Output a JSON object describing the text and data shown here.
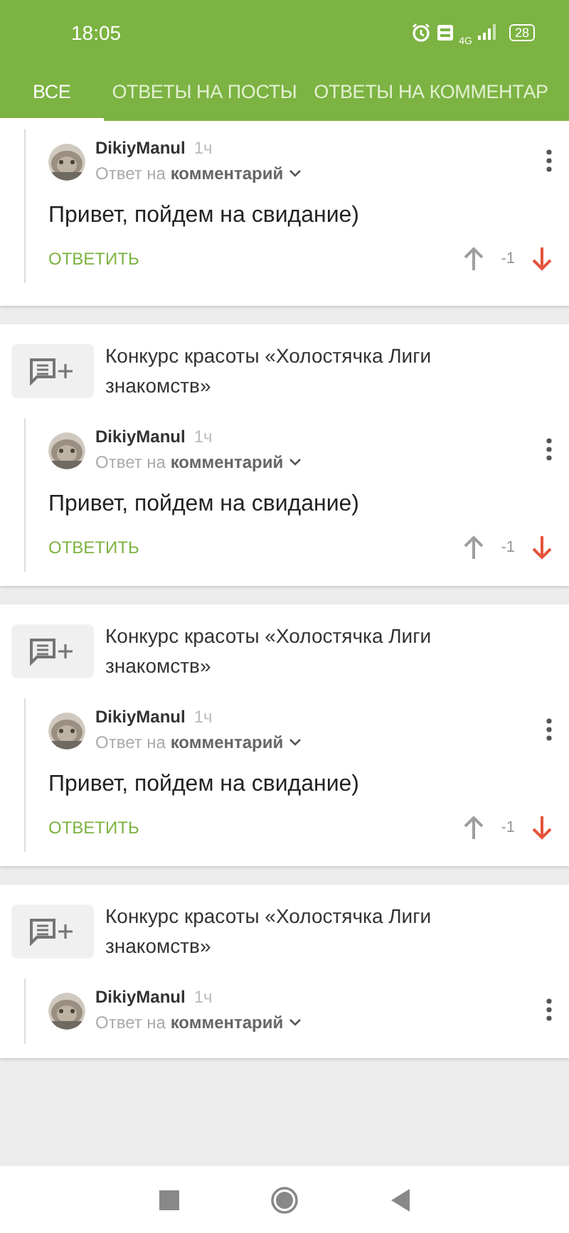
{
  "status_bar": {
    "time": "18:05",
    "network": "4G",
    "battery": "28"
  },
  "tabs": [
    {
      "label": "ВСЕ",
      "selected": true
    },
    {
      "label": "ОТВЕТЫ НА ПОСТЫ",
      "selected": false
    },
    {
      "label": "ОТВЕТЫ НА КОММЕНТАР",
      "selected": false
    }
  ],
  "cards": [
    {
      "comment": {
        "author": "DikiyManul",
        "time": "1ч",
        "context": "Ответ на **комментарий**",
        "text": "Привет, пойдем на свидание)",
        "reply": "ОТВЕТИТЬ",
        "score": "-1",
        "downvoted": true
      }
    },
    {
      "post_title": "Конкурс красоты «Холостячка Лиги знакомств»",
      "comment": {
        "author": "DikiyManul",
        "time": "1ч",
        "context": "Ответ на **комментарий**",
        "text": "Привет, пойдем на свидание)",
        "reply": "ОТВЕТИТЬ",
        "score": "-1",
        "downvoted": true
      }
    },
    {
      "post_title": "Конкурс красоты «Холостячка Лиги знакомств»",
      "comment": {
        "author": "DikiyManul",
        "time": "1ч",
        "context": "Ответ на **комментарий**",
        "text": "Привет, пойдем на свидание)",
        "reply": "ОТВЕТИТЬ",
        "score": "-1",
        "downvoted": true
      }
    },
    {
      "post_title": "Конкурс красоты «Холостячка Лиги знакомств»",
      "comment": {
        "author": "DikiyManul",
        "time": "1ч",
        "context": "Ответ на **комментарий**"
      }
    }
  ]
}
